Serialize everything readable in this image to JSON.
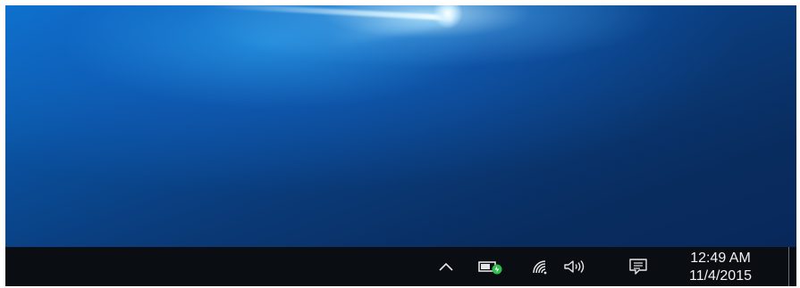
{
  "taskbar": {
    "tray": {
      "show_hidden_icons": "show-hidden-icons-chevron",
      "battery_icon": "battery-charging-icon",
      "wifi_icon": "wifi-icon",
      "volume_icon": "speaker-icon",
      "action_center_icon": "action-center-icon"
    },
    "clock": {
      "time": "12:49 AM",
      "date": "11/4/2015"
    }
  },
  "colors": {
    "taskbar_bg": "#0a0d12",
    "wallpaper_blue": "#0a4f9c",
    "battery_accent": "#2fbf4f"
  }
}
